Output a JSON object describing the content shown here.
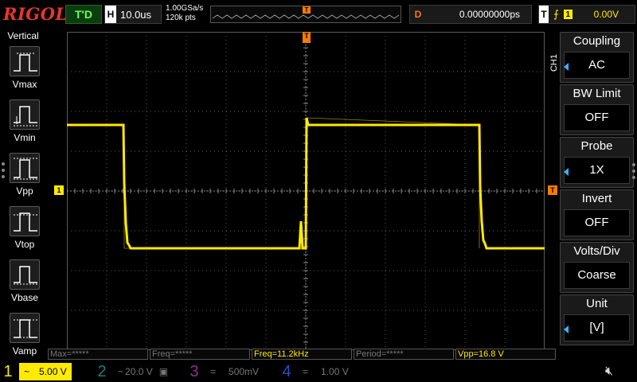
{
  "top": {
    "logo": "RIGOL",
    "run_status": "T'D",
    "timebase_label": "H",
    "timebase_value": "10.0us",
    "sample_rate": "1.00GSa/s",
    "memory_depth": "120k pts",
    "trigger_marker": "T",
    "delay_label": "D",
    "delay_value": "0.00000000ps",
    "trigger_label": "T",
    "trigger_edge_icon": "rising-edge-icon",
    "trigger_source": "1",
    "trigger_level": "0.00V"
  },
  "left_menu": {
    "title": "Vertical",
    "items": [
      {
        "label": "Vmax",
        "icon": "vmax-icon"
      },
      {
        "label": "Vmin",
        "icon": "vmin-icon"
      },
      {
        "label": "Vpp",
        "icon": "vpp-icon"
      },
      {
        "label": "Vtop",
        "icon": "vtop-icon"
      },
      {
        "label": "Vbase",
        "icon": "vbase-icon"
      },
      {
        "label": "Vamp",
        "icon": "vamp-icon"
      }
    ]
  },
  "screen": {
    "ch1_marker": "1",
    "trigger_level_marker": "T",
    "trigger_position_marker": "T",
    "channel_side_label": "CH1"
  },
  "right_menu": {
    "items": [
      {
        "title": "Coupling",
        "value": "AC"
      },
      {
        "title": "BW Limit",
        "value": "OFF"
      },
      {
        "title": "Probe",
        "value": "1X"
      },
      {
        "title": "Invert",
        "value": "OFF"
      },
      {
        "title": "Volts/Div",
        "value": "Coarse"
      },
      {
        "title": "Unit",
        "value": "[V]"
      }
    ]
  },
  "measurements": [
    {
      "text": "Max=*****",
      "active": false
    },
    {
      "text": "Freq=*****",
      "active": false
    },
    {
      "text": "Freq=11.2kHz",
      "active": true
    },
    {
      "text": "Period=*****",
      "active": false
    },
    {
      "text": "Vpp=16.8 V",
      "active": true
    }
  ],
  "channels": [
    {
      "num": "1",
      "coupling": "~",
      "scale": "5.00 V",
      "color": "#ffea00",
      "active": true
    },
    {
      "num": "2",
      "coupling": "~",
      "scale": "20.0 V",
      "color": "#1fa89a",
      "active": false
    },
    {
      "num": "3",
      "coupling": "=",
      "scale": "500mV",
      "color": "#c03cc8",
      "active": false
    },
    {
      "num": "4",
      "coupling": "=",
      "scale": "1.00 V",
      "color": "#3a6aff",
      "active": false
    }
  ],
  "colors": {
    "ch1": "#ffea00",
    "trigger": "#ff7a00",
    "grid": "#5a5a5a",
    "accent": "#3ab3ff"
  }
}
